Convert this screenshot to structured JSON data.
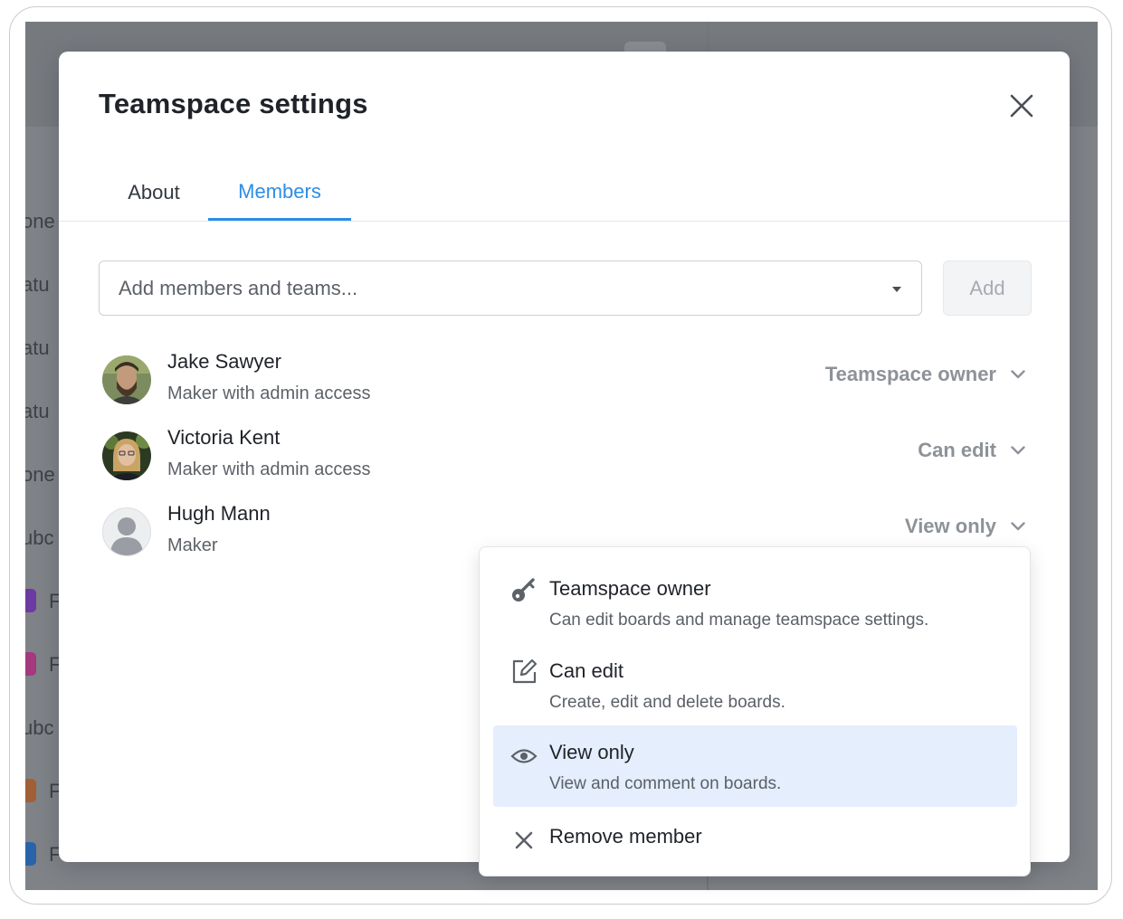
{
  "background": {
    "fragments": [
      "one",
      "atu",
      "atu",
      "atu",
      "one",
      "ubc",
      "F",
      "F",
      "ubc",
      "F",
      "F"
    ],
    "swatch_colors": [
      "#7a3fb8",
      "#b83f8f",
      "#b56a3a",
      "#2f6fc0"
    ]
  },
  "modal": {
    "title": "Teamspace settings",
    "close_icon": "close-icon"
  },
  "tabs": [
    {
      "label": "About",
      "active": false
    },
    {
      "label": "Members",
      "active": true
    }
  ],
  "search": {
    "placeholder": "Add members and teams...",
    "value": "",
    "add_label": "Add"
  },
  "members": [
    {
      "name": "Jake Sawyer",
      "role": "Maker with admin access",
      "permission": "Teamspace owner",
      "avatar": "photo"
    },
    {
      "name": "Victoria Kent",
      "role": "Maker with admin access",
      "permission": "Can edit",
      "avatar": "photo"
    },
    {
      "name": "Hugh Mann",
      "role": "Maker",
      "permission": "View only",
      "avatar": "default-user"
    }
  ],
  "dropdown": {
    "options": [
      {
        "icon": "key-icon",
        "title": "Teamspace owner",
        "description": "Can edit boards and manage teamspace settings.",
        "selected": false
      },
      {
        "icon": "edit-icon",
        "title": "Can edit",
        "description": "Create, edit and delete boards.",
        "selected": false
      },
      {
        "icon": "eye-icon",
        "title": "View only",
        "description": "View and comment on boards.",
        "selected": true
      },
      {
        "icon": "remove-icon",
        "title": "Remove member",
        "description": "",
        "selected": false
      }
    ]
  },
  "colors": {
    "accent": "#2c8de6",
    "selected_bg": "#e4eefc",
    "overlay": "#7f8388"
  }
}
